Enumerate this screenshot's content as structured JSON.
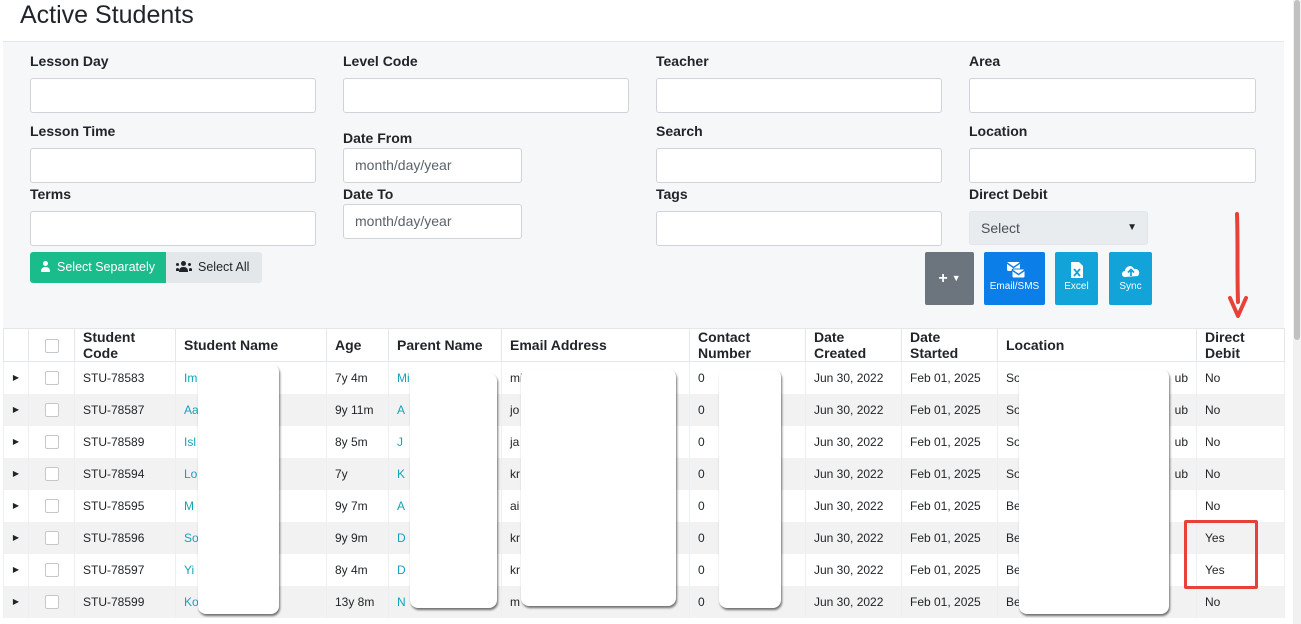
{
  "page": {
    "title": "Active Students"
  },
  "filters": {
    "lesson_day": {
      "label": "Lesson Day",
      "value": ""
    },
    "level_code": {
      "label": "Level Code",
      "value": ""
    },
    "teacher": {
      "label": "Teacher",
      "value": ""
    },
    "area": {
      "label": "Area",
      "value": ""
    },
    "lesson_time": {
      "label": "Lesson Time",
      "value": ""
    },
    "date_from": {
      "label": "Date From",
      "placeholder": "month/day/year"
    },
    "search": {
      "label": "Search",
      "value": ""
    },
    "location": {
      "label": "Location",
      "value": ""
    },
    "terms": {
      "label": "Terms",
      "value": ""
    },
    "date_to": {
      "label": "Date To",
      "placeholder": "month/day/year"
    },
    "tags": {
      "label": "Tags",
      "value": ""
    },
    "direct_debit": {
      "label": "Direct Debit",
      "selected": "Select"
    }
  },
  "selection": {
    "separately_label": "Select Separately",
    "all_label": "Select All"
  },
  "actions": {
    "plus_label": "+",
    "email_sms_label": "Email/SMS",
    "excel_label": "Excel",
    "sync_label": "Sync"
  },
  "colors": {
    "accent_green": "#1abc8c",
    "button_blue": "#0b7ee8",
    "link": "#17a2b8",
    "highlight_red": "#e8413a"
  },
  "table": {
    "columns": [
      "Student Code",
      "Student Name",
      "Age",
      "Parent Name",
      "Email Address",
      "Contact Number",
      "Date Created",
      "Date Started",
      "Location",
      "Direct Debit"
    ],
    "rows": [
      {
        "code": "STU-78583",
        "name": "Im",
        "age": "7y 4m",
        "parent": "Mi",
        "email": "mi",
        "contact": "0",
        "created": "Jun 30, 2022",
        "started": "Feb 01, 2025",
        "location": "So",
        "location_tail": "ub",
        "dd": "No"
      },
      {
        "code": "STU-78587",
        "name": "Aa",
        "age": "9y 11m",
        "parent": "A",
        "email": "jo",
        "contact": "0",
        "created": "Jun 30, 2022",
        "started": "Feb 01, 2025",
        "location": "So",
        "location_tail": "ub",
        "dd": "No"
      },
      {
        "code": "STU-78589",
        "name": "Isl",
        "age": "8y 5m",
        "parent": "J",
        "email": "ja",
        "contact": "0",
        "created": "Jun 30, 2022",
        "started": "Feb 01, 2025",
        "location": "So",
        "location_tail": "ub",
        "dd": "No"
      },
      {
        "code": "STU-78594",
        "name": "Lo",
        "age": "7y",
        "parent": "K",
        "email": "kr",
        "contact": "0",
        "created": "Jun 30, 2022",
        "started": "Feb 01, 2025",
        "location": "So",
        "location_tail": "ub",
        "dd": "No"
      },
      {
        "code": "STU-78595",
        "name": "M",
        "age": "9y 7m",
        "parent": "A",
        "email": "ai",
        "contact": "0",
        "created": "Jun 30, 2022",
        "started": "Feb 01, 2025",
        "location": "Be",
        "location_tail": "",
        "dd": "No"
      },
      {
        "code": "STU-78596",
        "name": "So",
        "age": "9y 9m",
        "parent": "D",
        "email": "kr",
        "contact": "0",
        "created": "Jun 30, 2022",
        "started": "Feb 01, 2025",
        "location": "Be",
        "location_tail": "",
        "dd": "Yes"
      },
      {
        "code": "STU-78597",
        "name": "Yi",
        "age": "8y 4m",
        "parent": "D",
        "email": "kr",
        "contact": "0",
        "created": "Jun 30, 2022",
        "started": "Feb 01, 2025",
        "location": "Be",
        "location_tail": "",
        "dd": "Yes"
      },
      {
        "code": "STU-78599",
        "name": "Ko",
        "age": "13y 8m",
        "parent": "N",
        "email": "m",
        "contact": "0",
        "created": "Jun 30, 2022",
        "started": "Feb 01, 2025",
        "location": "Be",
        "location_tail": "",
        "dd": "No"
      }
    ]
  }
}
